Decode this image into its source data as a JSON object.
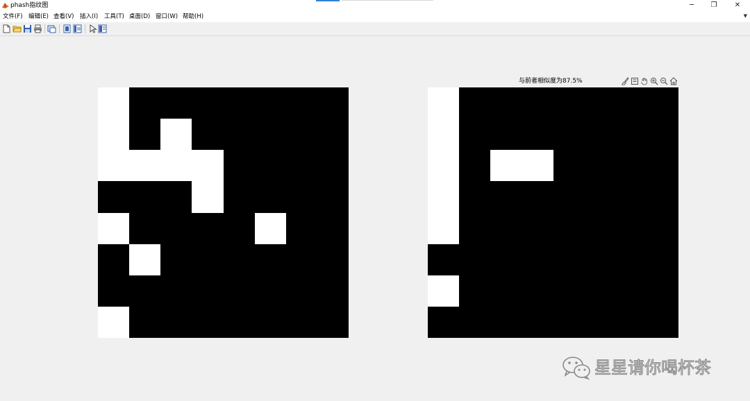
{
  "window": {
    "title": "phash指纹图"
  },
  "window_controls": {
    "minimize": "─",
    "restore": "❐",
    "close": "✕"
  },
  "menu": [
    "文件(F)",
    "编辑(E)",
    "查看(V)",
    "插入(I)",
    "工具(T)",
    "桌面(D)",
    "窗口(W)",
    "帮助(H)"
  ],
  "toolbar": [
    "new-file-icon",
    "open-folder-icon",
    "save-icon",
    "print-icon",
    "link-plot-icon",
    "hide-plot-tools-icon",
    "show-plot-tools-icon",
    "edit-plot-arrow-icon",
    "property-editor-icon"
  ],
  "axes_toolbar": [
    "brush-icon",
    "data-tips-icon",
    "pan-icon",
    "zoom-in-icon",
    "zoom-out-icon",
    "home-icon"
  ],
  "figure": {
    "title": "与前者相似度为87.5%",
    "left_grid": [
      [
        1,
        0,
        0,
        0,
        0,
        0,
        0,
        0
      ],
      [
        1,
        0,
        1,
        0,
        0,
        0,
        0,
        0
      ],
      [
        1,
        1,
        1,
        1,
        0,
        0,
        0,
        0
      ],
      [
        0,
        0,
        0,
        1,
        0,
        0,
        0,
        0
      ],
      [
        1,
        0,
        0,
        0,
        0,
        1,
        0,
        0
      ],
      [
        0,
        1,
        0,
        0,
        0,
        0,
        0,
        0
      ],
      [
        0,
        0,
        0,
        0,
        0,
        0,
        0,
        0
      ],
      [
        1,
        0,
        0,
        0,
        0,
        0,
        0,
        0
      ]
    ],
    "right_grid": [
      [
        1,
        0,
        0,
        0,
        0,
        0,
        0,
        0
      ],
      [
        1,
        0,
        0,
        0,
        0,
        0,
        0,
        0
      ],
      [
        1,
        0,
        1,
        1,
        0,
        0,
        0,
        0
      ],
      [
        1,
        0,
        0,
        0,
        0,
        0,
        0,
        0
      ],
      [
        1,
        0,
        0,
        0,
        0,
        0,
        0,
        0
      ],
      [
        0,
        0,
        0,
        0,
        0,
        0,
        0,
        0
      ],
      [
        1,
        0,
        0,
        0,
        0,
        0,
        0,
        0
      ],
      [
        0,
        0,
        0,
        0,
        0,
        0,
        0,
        0
      ]
    ],
    "colors": {
      "on": "#ffffff",
      "off": "#000000"
    }
  },
  "watermark": {
    "text": "星星请你喝杯茶"
  }
}
